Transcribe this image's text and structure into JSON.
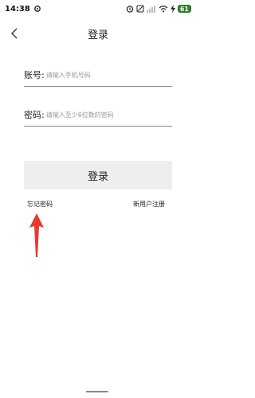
{
  "status_bar": {
    "time": "14:38",
    "battery": "61",
    "icons": [
      "settings-gear-icon",
      "alarm-icon",
      "mute-icon",
      "signal-icon",
      "wifi-icon",
      "charging-icon"
    ]
  },
  "nav": {
    "back_icon": "chevron-left-icon",
    "title": "登录"
  },
  "form": {
    "account_label": "账号:",
    "account_placeholder": "请输入手机号码",
    "password_label": "密码:",
    "password_placeholder": "请输入至少6位数的密码",
    "login_button": "登录"
  },
  "links": {
    "forgot_password": "忘记密码",
    "register": "新用户注册"
  },
  "colors": {
    "annotation_arrow": "#e53935",
    "button_bg": "#eeeeee",
    "battery": "#2e7d32"
  }
}
